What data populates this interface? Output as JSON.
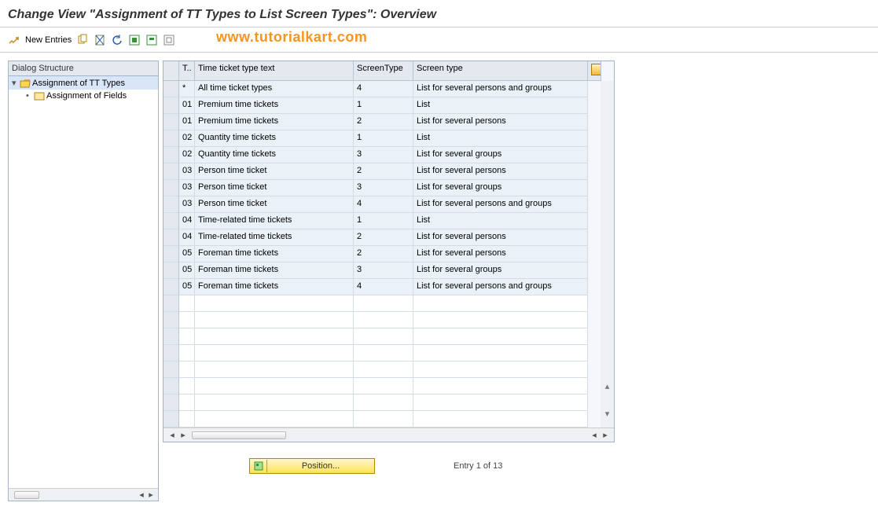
{
  "title": "Change View \"Assignment of TT Types to List Screen Types\": Overview",
  "watermark": "www.tutorialkart.com",
  "toolbar": {
    "new_entries": "New Entries"
  },
  "tree": {
    "header": "Dialog Structure",
    "node1": "Assignment of TT Types",
    "node2": "Assignment of Fields"
  },
  "table": {
    "headers": {
      "t": "T..",
      "txt": "Time ticket type text",
      "st": "ScreenType",
      "stt": "Screen type"
    },
    "rows": [
      {
        "t": "*",
        "txt": "All time ticket types",
        "st": "4",
        "stt": "List for several persons and groups"
      },
      {
        "t": "01",
        "txt": "Premium time tickets",
        "st": "1",
        "stt": "List"
      },
      {
        "t": "01",
        "txt": "Premium time tickets",
        "st": "2",
        "stt": "List for several persons"
      },
      {
        "t": "02",
        "txt": "Quantity time tickets",
        "st": "1",
        "stt": "List"
      },
      {
        "t": "02",
        "txt": "Quantity time tickets",
        "st": "3",
        "stt": "List for several groups"
      },
      {
        "t": "03",
        "txt": "Person time ticket",
        "st": "2",
        "stt": "List for several persons"
      },
      {
        "t": "03",
        "txt": "Person time ticket",
        "st": "3",
        "stt": "List for several groups"
      },
      {
        "t": "03",
        "txt": "Person time ticket",
        "st": "4",
        "stt": "List for several persons and groups"
      },
      {
        "t": "04",
        "txt": "Time-related time tickets",
        "st": "1",
        "stt": "List"
      },
      {
        "t": "04",
        "txt": "Time-related time tickets",
        "st": "2",
        "stt": "List for several persons"
      },
      {
        "t": "05",
        "txt": "Foreman time tickets",
        "st": "2",
        "stt": "List for several persons"
      },
      {
        "t": "05",
        "txt": "Foreman time tickets",
        "st": "3",
        "stt": "List for several groups"
      },
      {
        "t": "05",
        "txt": "Foreman time tickets",
        "st": "4",
        "stt": "List for several persons and groups"
      }
    ]
  },
  "footer": {
    "position": "Position...",
    "entry": "Entry 1 of 13"
  }
}
